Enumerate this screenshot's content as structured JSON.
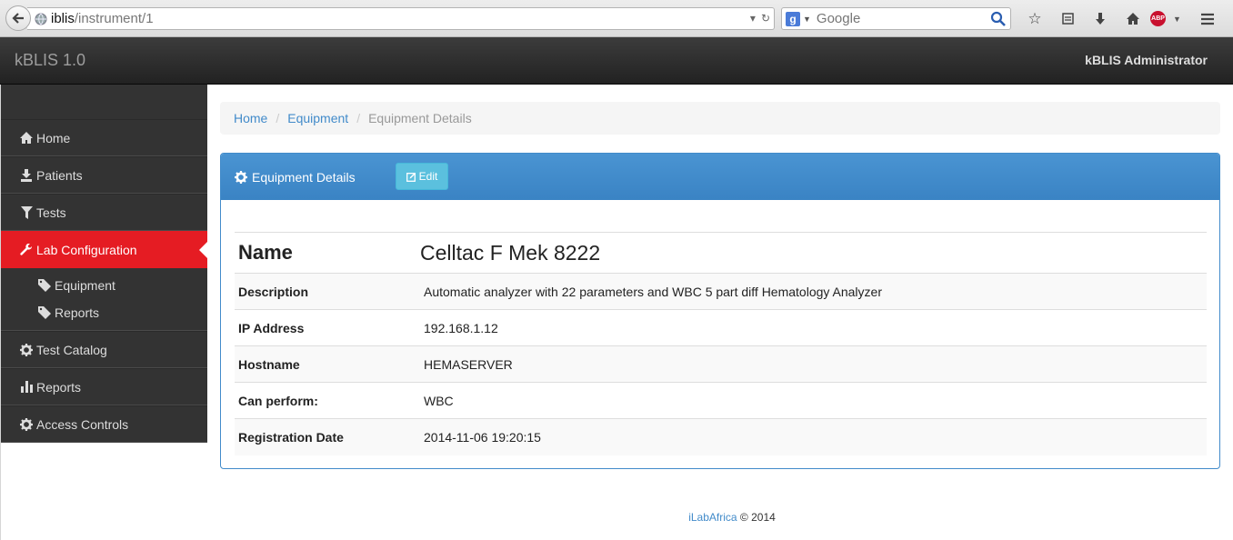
{
  "browser": {
    "url_host": "iblis",
    "url_path": "/instrument/1",
    "search_placeholder": "Google"
  },
  "navbar": {
    "brand": "kBLIS 1.0",
    "user": "kBLIS Administrator"
  },
  "sidebar": {
    "items": [
      {
        "label": "Home",
        "icon": "home-icon"
      },
      {
        "label": "Patients",
        "icon": "download-icon"
      },
      {
        "label": "Tests",
        "icon": "filter-icon"
      },
      {
        "label": "Lab Configuration",
        "icon": "wrench-icon"
      },
      {
        "label": "Test Catalog",
        "icon": "cog-icon"
      },
      {
        "label": "Reports",
        "icon": "stats-icon"
      },
      {
        "label": "Access Controls",
        "icon": "cog-icon"
      }
    ],
    "sub_items": [
      {
        "label": "Equipment",
        "icon": "tag-icon"
      },
      {
        "label": "Reports",
        "icon": "tag-icon"
      }
    ],
    "active_color": "#e51c23"
  },
  "breadcrumb": {
    "home": "Home",
    "equipment": "Equipment",
    "current": "Equipment Details"
  },
  "panel": {
    "title": "Equipment Details",
    "edit_label": "Edit",
    "accent": "#428bca"
  },
  "details": {
    "name_label": "Name",
    "name_value": "Celltac F Mek 8222",
    "rows": [
      {
        "label": "Description",
        "value": "Automatic analyzer with 22 parameters and WBC 5 part diff Hematology Analyzer"
      },
      {
        "label": "IP Address",
        "value": "192.168.1.12"
      },
      {
        "label": "Hostname",
        "value": "HEMASERVER"
      },
      {
        "label": "Can perform:",
        "value": "WBC"
      },
      {
        "label": "Registration Date",
        "value": "2014-11-06 19:20:15"
      }
    ]
  },
  "footer": {
    "link": "iLabAfrica",
    "rest": "© 2014"
  }
}
